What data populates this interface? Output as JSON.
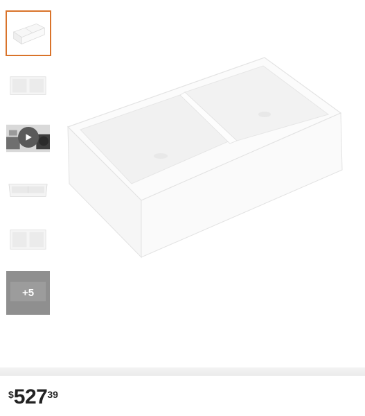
{
  "gallery": {
    "more_count_label": "+5",
    "selected_border_color": "#d9732a"
  },
  "price": {
    "currency": "$",
    "dollars": "527",
    "cents": "39"
  }
}
